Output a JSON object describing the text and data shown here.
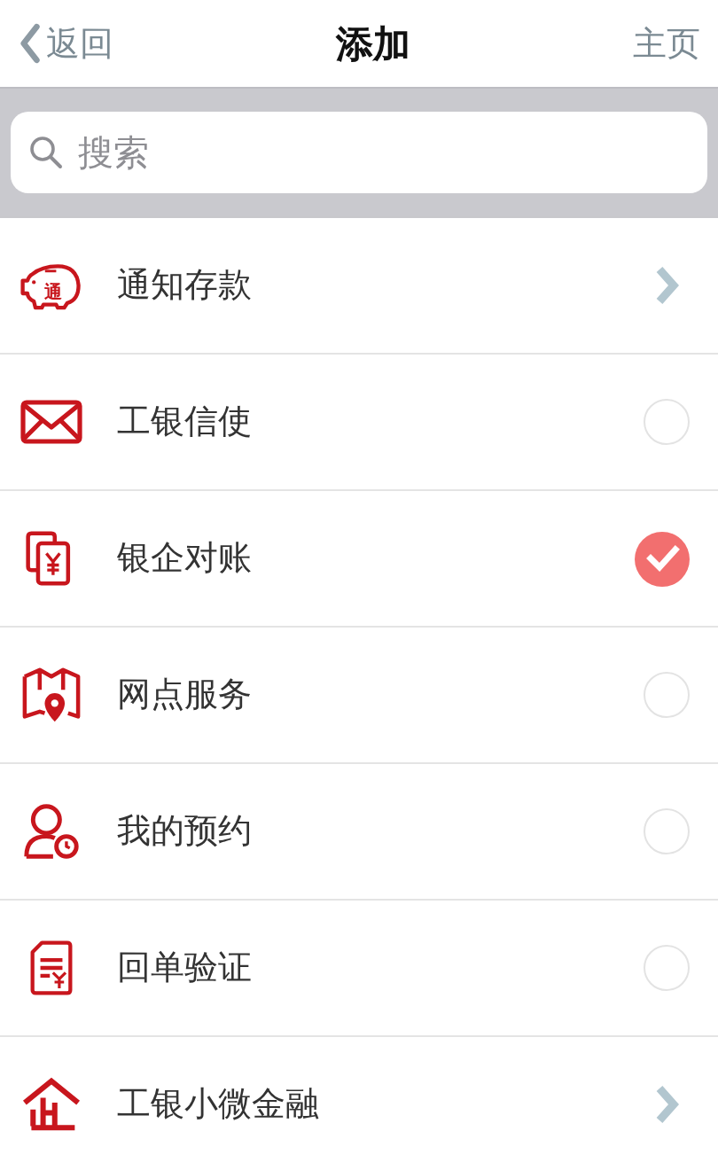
{
  "nav": {
    "back": "返回",
    "title": "添加",
    "home": "主页"
  },
  "search": {
    "placeholder": "搜索"
  },
  "items": [
    {
      "label": "通知存款",
      "kind": "link",
      "icon_text": "通"
    },
    {
      "label": "工银信使",
      "kind": "toggle",
      "checked": false
    },
    {
      "label": "银企对账",
      "kind": "toggle",
      "checked": true
    },
    {
      "label": "网点服务",
      "kind": "toggle",
      "checked": false
    },
    {
      "label": "我的预约",
      "kind": "toggle",
      "checked": false
    },
    {
      "label": "回单验证",
      "kind": "toggle",
      "checked": false
    },
    {
      "label": "工银小微金融",
      "kind": "link"
    }
  ]
}
